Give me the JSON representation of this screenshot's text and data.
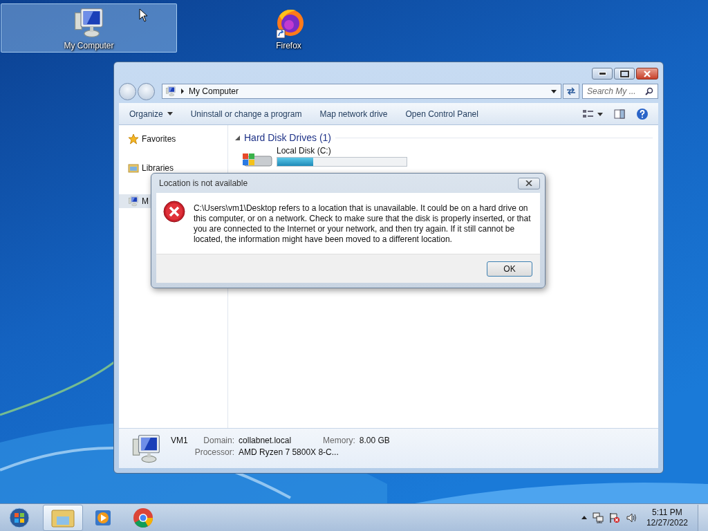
{
  "desktop_icons": [
    {
      "label": "My Computer",
      "kind": "computer",
      "selected": true
    },
    {
      "label": "Firefox",
      "kind": "firefox",
      "selected": false
    }
  ],
  "explorer": {
    "address": "My Computer",
    "search": {
      "placeholder": "Search My ..."
    },
    "toolbar": [
      {
        "label": "Organize",
        "dropdown": true
      },
      {
        "label": "Uninstall or change a program",
        "dropdown": false
      },
      {
        "label": "Map network drive",
        "dropdown": false
      },
      {
        "label": "Open Control Panel",
        "dropdown": false
      }
    ],
    "sidebar": [
      {
        "label": "Favorites",
        "kind": "star",
        "selected": false
      },
      {
        "label": "Libraries",
        "kind": "library",
        "selected": false
      },
      {
        "label": "M",
        "kind": "computer",
        "selected": true
      }
    ],
    "section": {
      "title": "Hard Disk Drives (1)",
      "expanded": true
    },
    "drives": [
      {
        "label": "Local Disk (C:)",
        "level": 0.28
      }
    ],
    "details": {
      "name": "VM1",
      "fields": [
        {
          "label": "Domain:",
          "value": "collabnet.local"
        },
        {
          "label": "Memory:",
          "value": "8.00 GB"
        },
        {
          "label": "Processor:",
          "value": "AMD Ryzen 7 5800X 8-C..."
        }
      ]
    }
  },
  "dialog": {
    "title": "Location is not available",
    "message": "C:\\Users\\vm1\\Desktop refers to a location that is unavailable. It could be on a hard drive on this computer, or on a network. Check to make sure that the disk is properly inserted, or that you are connected to the Internet or your network, and then try again. If it still cannot be located, the information might have been moved to a different location.",
    "buttons": [
      "OK"
    ]
  },
  "taskbar": {
    "apps": [
      {
        "kind": "explorer",
        "selected": true
      },
      {
        "kind": "media",
        "selected": false
      },
      {
        "kind": "chrome",
        "selected": false
      }
    ],
    "clock": {
      "time": "5:11 PM",
      "date": "12/27/2022"
    }
  }
}
